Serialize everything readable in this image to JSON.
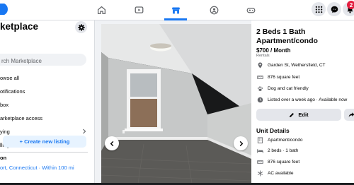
{
  "nav": {
    "tabs": [
      {
        "name": "home",
        "icon": "home-icon"
      },
      {
        "name": "watch",
        "icon": "video-icon"
      },
      {
        "name": "marketplace",
        "icon": "marketplace-icon",
        "active": true
      },
      {
        "name": "groups",
        "icon": "groups-icon"
      },
      {
        "name": "gaming",
        "icon": "gaming-icon"
      }
    ],
    "notification_count": "2",
    "accent_color": "#1877f2"
  },
  "sidebar": {
    "title": "ketplace",
    "search_placeholder": "rch Marketplace",
    "items": [
      {
        "label": "owse all"
      },
      {
        "label": "otifications"
      },
      {
        "label": "box"
      },
      {
        "label": "arketplace access"
      },
      {
        "label": "ying"
      },
      {
        "label": "lling"
      }
    ],
    "create_listing_label": "+ Create new listing",
    "location_label": "on",
    "location_value": "ort, Connecticut · Within 100 mi"
  },
  "listing": {
    "title": "2 Beds 1 Bath Apartment/condo",
    "price": "$700 / Month",
    "category": "Rentals",
    "address": "Garden St, Wethersfield, CT",
    "area": "876 square feet",
    "pets": "Dog and cat friendly",
    "listed": "Listed over a week ago · Available now",
    "edit_label": "Edit",
    "unit_details_heading": "Unit Details",
    "unit_details": [
      {
        "icon": "building-icon",
        "text": "Apartment/condo"
      },
      {
        "icon": "bed-icon",
        "text": "2 beds · 1 bath"
      },
      {
        "icon": "ruler-icon",
        "text": "876 square feet"
      },
      {
        "icon": "snowflake-icon",
        "text": "AC available"
      }
    ]
  }
}
